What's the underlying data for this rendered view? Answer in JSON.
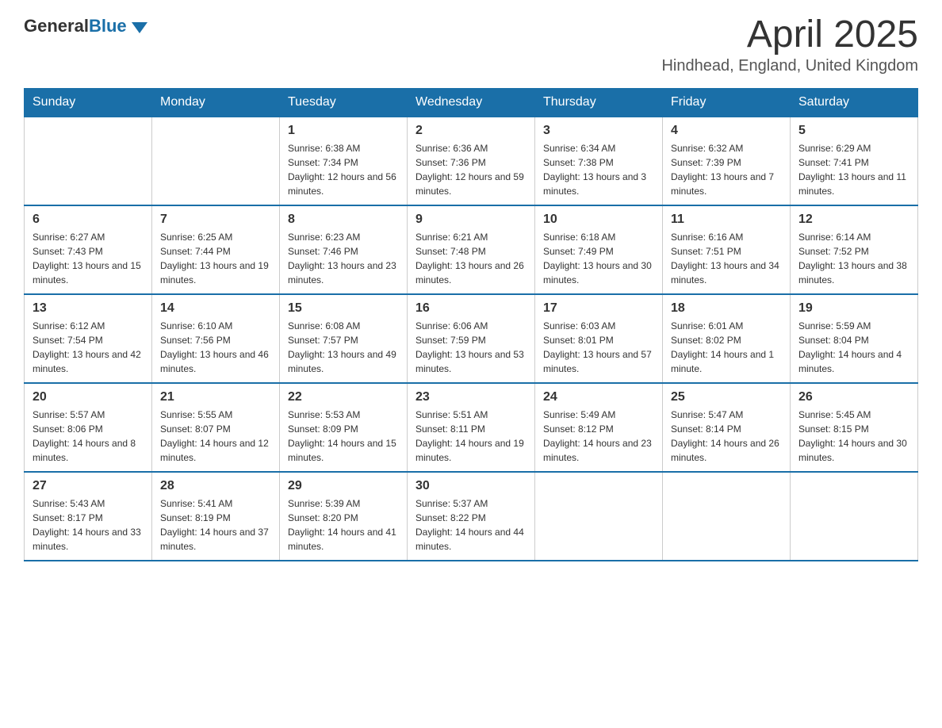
{
  "header": {
    "logo": {
      "text_general": "General",
      "text_blue": "Blue"
    },
    "title": "April 2025",
    "location": "Hindhead, England, United Kingdom"
  },
  "calendar": {
    "weekdays": [
      "Sunday",
      "Monday",
      "Tuesday",
      "Wednesday",
      "Thursday",
      "Friday",
      "Saturday"
    ],
    "weeks": [
      [
        {
          "day": "",
          "sunrise": "",
          "sunset": "",
          "daylight": ""
        },
        {
          "day": "",
          "sunrise": "",
          "sunset": "",
          "daylight": ""
        },
        {
          "day": "1",
          "sunrise": "Sunrise: 6:38 AM",
          "sunset": "Sunset: 7:34 PM",
          "daylight": "Daylight: 12 hours and 56 minutes."
        },
        {
          "day": "2",
          "sunrise": "Sunrise: 6:36 AM",
          "sunset": "Sunset: 7:36 PM",
          "daylight": "Daylight: 12 hours and 59 minutes."
        },
        {
          "day": "3",
          "sunrise": "Sunrise: 6:34 AM",
          "sunset": "Sunset: 7:38 PM",
          "daylight": "Daylight: 13 hours and 3 minutes."
        },
        {
          "day": "4",
          "sunrise": "Sunrise: 6:32 AM",
          "sunset": "Sunset: 7:39 PM",
          "daylight": "Daylight: 13 hours and 7 minutes."
        },
        {
          "day": "5",
          "sunrise": "Sunrise: 6:29 AM",
          "sunset": "Sunset: 7:41 PM",
          "daylight": "Daylight: 13 hours and 11 minutes."
        }
      ],
      [
        {
          "day": "6",
          "sunrise": "Sunrise: 6:27 AM",
          "sunset": "Sunset: 7:43 PM",
          "daylight": "Daylight: 13 hours and 15 minutes."
        },
        {
          "day": "7",
          "sunrise": "Sunrise: 6:25 AM",
          "sunset": "Sunset: 7:44 PM",
          "daylight": "Daylight: 13 hours and 19 minutes."
        },
        {
          "day": "8",
          "sunrise": "Sunrise: 6:23 AM",
          "sunset": "Sunset: 7:46 PM",
          "daylight": "Daylight: 13 hours and 23 minutes."
        },
        {
          "day": "9",
          "sunrise": "Sunrise: 6:21 AM",
          "sunset": "Sunset: 7:48 PM",
          "daylight": "Daylight: 13 hours and 26 minutes."
        },
        {
          "day": "10",
          "sunrise": "Sunrise: 6:18 AM",
          "sunset": "Sunset: 7:49 PM",
          "daylight": "Daylight: 13 hours and 30 minutes."
        },
        {
          "day": "11",
          "sunrise": "Sunrise: 6:16 AM",
          "sunset": "Sunset: 7:51 PM",
          "daylight": "Daylight: 13 hours and 34 minutes."
        },
        {
          "day": "12",
          "sunrise": "Sunrise: 6:14 AM",
          "sunset": "Sunset: 7:52 PM",
          "daylight": "Daylight: 13 hours and 38 minutes."
        }
      ],
      [
        {
          "day": "13",
          "sunrise": "Sunrise: 6:12 AM",
          "sunset": "Sunset: 7:54 PM",
          "daylight": "Daylight: 13 hours and 42 minutes."
        },
        {
          "day": "14",
          "sunrise": "Sunrise: 6:10 AM",
          "sunset": "Sunset: 7:56 PM",
          "daylight": "Daylight: 13 hours and 46 minutes."
        },
        {
          "day": "15",
          "sunrise": "Sunrise: 6:08 AM",
          "sunset": "Sunset: 7:57 PM",
          "daylight": "Daylight: 13 hours and 49 minutes."
        },
        {
          "day": "16",
          "sunrise": "Sunrise: 6:06 AM",
          "sunset": "Sunset: 7:59 PM",
          "daylight": "Daylight: 13 hours and 53 minutes."
        },
        {
          "day": "17",
          "sunrise": "Sunrise: 6:03 AM",
          "sunset": "Sunset: 8:01 PM",
          "daylight": "Daylight: 13 hours and 57 minutes."
        },
        {
          "day": "18",
          "sunrise": "Sunrise: 6:01 AM",
          "sunset": "Sunset: 8:02 PM",
          "daylight": "Daylight: 14 hours and 1 minute."
        },
        {
          "day": "19",
          "sunrise": "Sunrise: 5:59 AM",
          "sunset": "Sunset: 8:04 PM",
          "daylight": "Daylight: 14 hours and 4 minutes."
        }
      ],
      [
        {
          "day": "20",
          "sunrise": "Sunrise: 5:57 AM",
          "sunset": "Sunset: 8:06 PM",
          "daylight": "Daylight: 14 hours and 8 minutes."
        },
        {
          "day": "21",
          "sunrise": "Sunrise: 5:55 AM",
          "sunset": "Sunset: 8:07 PM",
          "daylight": "Daylight: 14 hours and 12 minutes."
        },
        {
          "day": "22",
          "sunrise": "Sunrise: 5:53 AM",
          "sunset": "Sunset: 8:09 PM",
          "daylight": "Daylight: 14 hours and 15 minutes."
        },
        {
          "day": "23",
          "sunrise": "Sunrise: 5:51 AM",
          "sunset": "Sunset: 8:11 PM",
          "daylight": "Daylight: 14 hours and 19 minutes."
        },
        {
          "day": "24",
          "sunrise": "Sunrise: 5:49 AM",
          "sunset": "Sunset: 8:12 PM",
          "daylight": "Daylight: 14 hours and 23 minutes."
        },
        {
          "day": "25",
          "sunrise": "Sunrise: 5:47 AM",
          "sunset": "Sunset: 8:14 PM",
          "daylight": "Daylight: 14 hours and 26 minutes."
        },
        {
          "day": "26",
          "sunrise": "Sunrise: 5:45 AM",
          "sunset": "Sunset: 8:15 PM",
          "daylight": "Daylight: 14 hours and 30 minutes."
        }
      ],
      [
        {
          "day": "27",
          "sunrise": "Sunrise: 5:43 AM",
          "sunset": "Sunset: 8:17 PM",
          "daylight": "Daylight: 14 hours and 33 minutes."
        },
        {
          "day": "28",
          "sunrise": "Sunrise: 5:41 AM",
          "sunset": "Sunset: 8:19 PM",
          "daylight": "Daylight: 14 hours and 37 minutes."
        },
        {
          "day": "29",
          "sunrise": "Sunrise: 5:39 AM",
          "sunset": "Sunset: 8:20 PM",
          "daylight": "Daylight: 14 hours and 41 minutes."
        },
        {
          "day": "30",
          "sunrise": "Sunrise: 5:37 AM",
          "sunset": "Sunset: 8:22 PM",
          "daylight": "Daylight: 14 hours and 44 minutes."
        },
        {
          "day": "",
          "sunrise": "",
          "sunset": "",
          "daylight": ""
        },
        {
          "day": "",
          "sunrise": "",
          "sunset": "",
          "daylight": ""
        },
        {
          "day": "",
          "sunrise": "",
          "sunset": "",
          "daylight": ""
        }
      ]
    ]
  }
}
